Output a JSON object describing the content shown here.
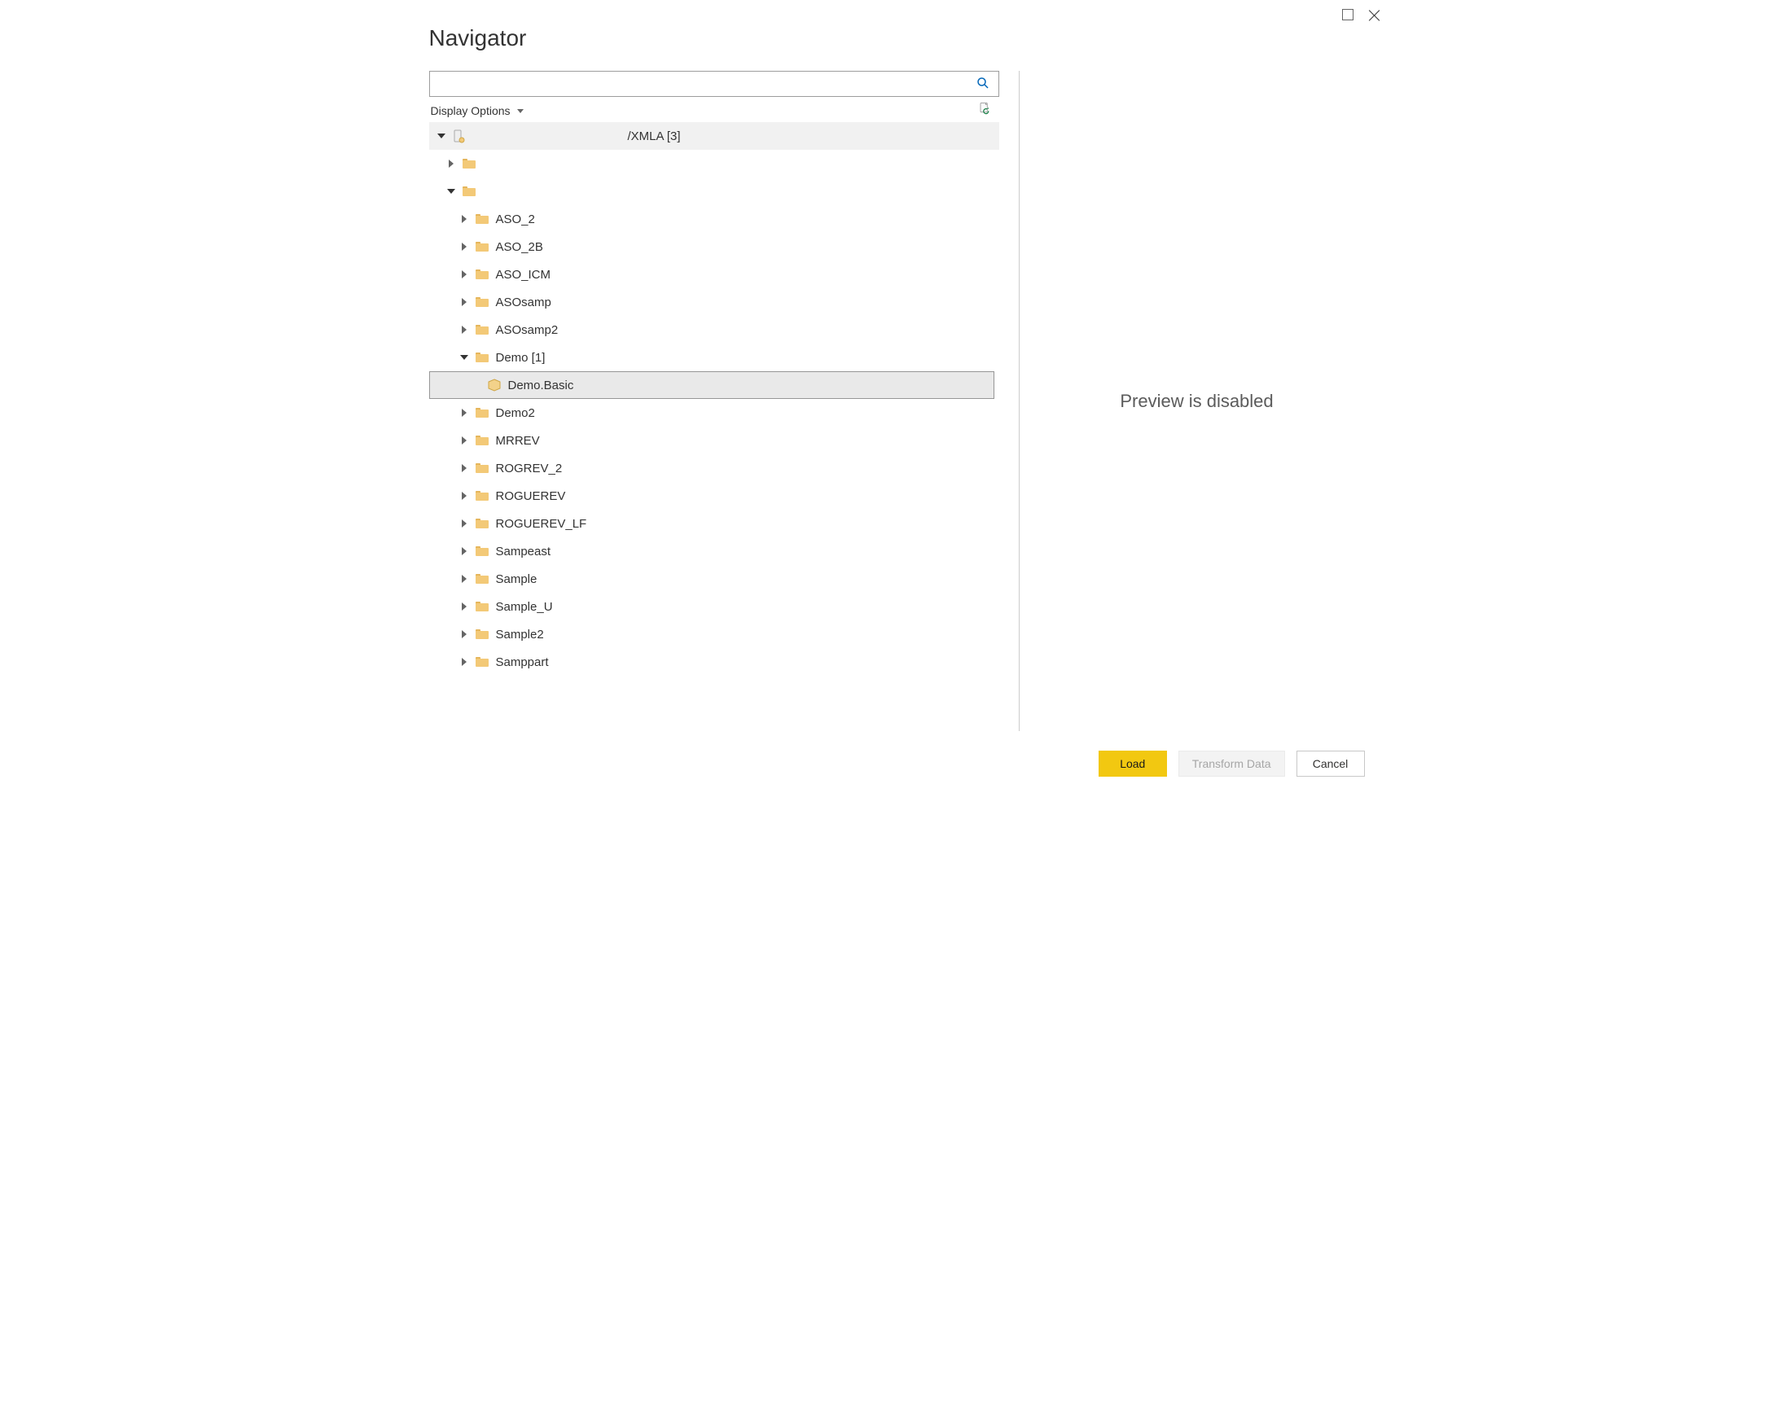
{
  "window": {
    "title": "Navigator"
  },
  "search": {
    "value": "",
    "placeholder": ""
  },
  "options": {
    "display_options_label": "Display Options"
  },
  "preview": {
    "message": "Preview is disabled"
  },
  "footer": {
    "load": "Load",
    "transform": "Transform Data",
    "cancel": "Cancel"
  },
  "tree": {
    "root": {
      "icon": "server",
      "label_suffix": "/XMLA [3]",
      "expanded": true,
      "children": [
        {
          "icon": "folder",
          "label": "",
          "expanded": false,
          "children": []
        },
        {
          "icon": "folder",
          "label": "",
          "expanded": true,
          "children": [
            {
              "icon": "folder",
              "label": "ASO_2",
              "expanded": false
            },
            {
              "icon": "folder",
              "label": "ASO_2B",
              "expanded": false
            },
            {
              "icon": "folder",
              "label": "ASO_ICM",
              "expanded": false
            },
            {
              "icon": "folder",
              "label": "ASOsamp",
              "expanded": false
            },
            {
              "icon": "folder",
              "label": "ASOsamp2",
              "expanded": false
            },
            {
              "icon": "folder",
              "label": "Demo [1]",
              "expanded": true,
              "children": [
                {
                  "icon": "cube",
                  "label": "Demo.Basic",
                  "selected": true
                }
              ]
            },
            {
              "icon": "folder",
              "label": "Demo2",
              "expanded": false
            },
            {
              "icon": "folder",
              "label": "MRREV",
              "expanded": false
            },
            {
              "icon": "folder",
              "label": "ROGREV_2",
              "expanded": false
            },
            {
              "icon": "folder",
              "label": "ROGUEREV",
              "expanded": false
            },
            {
              "icon": "folder",
              "label": "ROGUEREV_LF",
              "expanded": false
            },
            {
              "icon": "folder",
              "label": "Sampeast",
              "expanded": false
            },
            {
              "icon": "folder",
              "label": "Sample",
              "expanded": false
            },
            {
              "icon": "folder",
              "label": "Sample_U",
              "expanded": false
            },
            {
              "icon": "folder",
              "label": "Sample2",
              "expanded": false
            },
            {
              "icon": "folder",
              "label": "Samppart",
              "expanded": false
            }
          ]
        }
      ]
    }
  }
}
